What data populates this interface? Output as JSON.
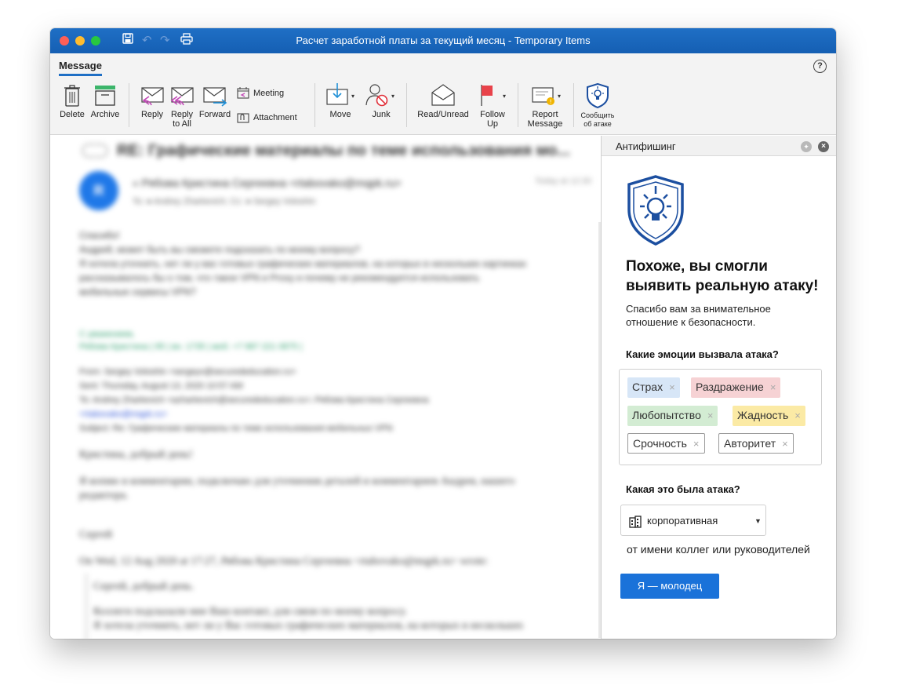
{
  "window": {
    "title": "Расчет заработной платы за текущий месяц - Temporary Items"
  },
  "ribbon": {
    "tab": "Message",
    "buttons": {
      "delete": "Delete",
      "archive": "Archive",
      "reply": "Reply",
      "reply_all_1": "Reply",
      "reply_all_2": "to All",
      "forward": "Forward",
      "meeting": "Meeting",
      "attachment": "Attachment",
      "move": "Move",
      "junk": "Junk",
      "read_unread": "Read/Unread",
      "follow_up_1": "Follow",
      "follow_up_2": "Up",
      "report_1": "Report",
      "report_2": "Message",
      "report_attack_1": "Сообщить",
      "report_attack_2": "об атаке"
    }
  },
  "email": {
    "subject": "RE: Графические материалы по теме использования мо...",
    "avatar": "R",
    "from": "« Рябова Кристина Сергеевна <rtabovako@mqpk.ru>",
    "to_line": "To:  ● Andrey Zharkevich;  Cc:  ● Sergey Voloshin",
    "time": "Today at 12:30",
    "body": [
      "Спасибо!",
      "Андрей, может быть вы сможете подсказать по моему вопросу?",
      "Я хотела уточнить, нет ли у вас готовых графических материалов, на которых в нескольких картинках",
      "рассказывалось бы о том, что такое VPN и Proxy и почему не рекомендуется использовать",
      "мобильные сервисы VPN?"
    ],
    "signature": [
      "С уважением,",
      "Рябова Кристина | 95 | вн. 1735 | моб. +7 987 221 0875 |"
    ],
    "header_block": [
      "From: Sergey Voloshin <sergeyv@securededucation.ru>",
      "Sent: Thursday, August 13, 2020 10:57 AM",
      "To: Andrey Zharkevich <azharkevich@securededucation.ru>; Рябова Кристина Сергеевна",
      "<rtabovako@mqpk.ru>",
      "Subject: Re: Графические материалы по теме использования мобильных VPN"
    ],
    "greeting": "Кристина, добрый день!",
    "para": [
      "Я копию в комментарии, подключаю для уточнения деталей и комментариев Андрея, нашего",
      "редактора."
    ],
    "name": "Сергей",
    "wrote": "On Wed, 12 Aug 2020 at 17:27, Рябова Кристина Сергеевна <rtabovako@mqpk.ru> wrote:",
    "quote": [
      "Сергей, добрый день.",
      "Коллеги подсказали мне Ваш контакт, для связи по моему вопросу.",
      "Я хотела уточнить, нет ли у Вас готовых графических материалов, на которых в нескольких"
    ]
  },
  "panel": {
    "title": "Антифишинг",
    "headline": "Похоже, вы смогли выявить реальную атаку!",
    "thanks": "Спасибо вам за внимательное отношение к безопасности.",
    "emotions_question": "Какие эмоции вызвала атака?",
    "tags": [
      {
        "label": "Страх",
        "color": "#d7e6f7"
      },
      {
        "label": "Раздражение",
        "color": "#f6d2d4"
      },
      {
        "label": "Любопытство",
        "color": "#d3ecd3"
      },
      {
        "label": "Жадность",
        "color": "#fbeaa5"
      },
      {
        "label": "Срочность",
        "color": "#ffffff"
      },
      {
        "label": "Авторитет",
        "color": "#ffffff"
      }
    ],
    "tag_remove": "×",
    "attack_question": "Какая это была атака?",
    "attack_type": "корпоративная",
    "attack_desc": "от имени коллег или руководителей",
    "submit": "Я — молодец"
  },
  "colors": {
    "titlebar": "#1f6fc5",
    "accent": "#1a72d9",
    "logo": "#1c4fa0"
  }
}
